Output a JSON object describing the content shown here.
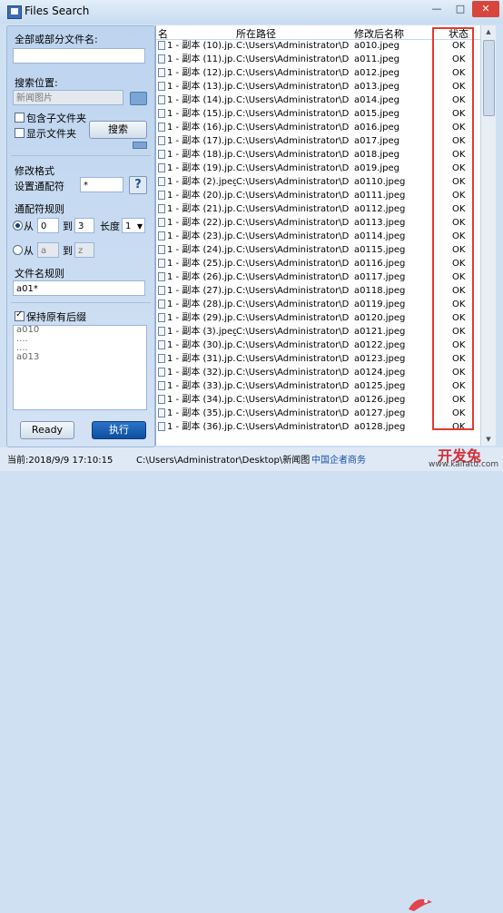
{
  "window": {
    "title": "Files Search",
    "min": "—",
    "max": "□",
    "close": "✕"
  },
  "left": {
    "name_label": "全部或部分文件名:",
    "name_value": "",
    "location_label": "搜索位置:",
    "location_value": "新闻图片",
    "include_subfolders": "包含子文件夹",
    "show_folders": "显示文件夹",
    "search_button": "搜索",
    "modify_format": "修改格式",
    "wildcard_label": "设置通配符",
    "wildcard_value": "*",
    "help_button": "?",
    "wildcard_rules": "通配符规则",
    "from1": "从",
    "from1_value": "0",
    "to1": "到",
    "to1_value": "3",
    "length_label": "长度",
    "length_value": "1",
    "from2": "从",
    "from2_value": "a",
    "to2": "到",
    "to2_value": "z",
    "filename_rule": "文件名规则",
    "filename_value": "a01*",
    "keep_ext": "保持原有后缀",
    "preview": [
      "a010",
      "....",
      "....",
      "a013"
    ],
    "ready_button": "Ready",
    "exec_button": "执行"
  },
  "grid": {
    "headers": [
      "名",
      "所在路径",
      "修改后名称",
      "状态"
    ],
    "rows": [
      [
        "1 - 副本 (10).jp...",
        "C:\\Users\\Administrator\\De...",
        "a010.jpeg",
        "OK"
      ],
      [
        "1 - 副本 (11).jp...",
        "C:\\Users\\Administrator\\De...",
        "a011.jpeg",
        "OK"
      ],
      [
        "1 - 副本 (12).jp...",
        "C:\\Users\\Administrator\\De...",
        "a012.jpeg",
        "OK"
      ],
      [
        "1 - 副本 (13).jp...",
        "C:\\Users\\Administrator\\De...",
        "a013.jpeg",
        "OK"
      ],
      [
        "1 - 副本 (14).jp...",
        "C:\\Users\\Administrator\\De...",
        "a014.jpeg",
        "OK"
      ],
      [
        "1 - 副本 (15).jp...",
        "C:\\Users\\Administrator\\De...",
        "a015.jpeg",
        "OK"
      ],
      [
        "1 - 副本 (16).jp...",
        "C:\\Users\\Administrator\\De...",
        "a016.jpeg",
        "OK"
      ],
      [
        "1 - 副本 (17).jp...",
        "C:\\Users\\Administrator\\De...",
        "a017.jpeg",
        "OK"
      ],
      [
        "1 - 副本 (18).jp...",
        "C:\\Users\\Administrator\\De...",
        "a018.jpeg",
        "OK"
      ],
      [
        "1 - 副本 (19).jp...",
        "C:\\Users\\Administrator\\De...",
        "a019.jpeg",
        "OK"
      ],
      [
        "1 - 副本 (2).jpeg",
        "C:\\Users\\Administrator\\De...",
        "a0110.jpeg",
        "OK"
      ],
      [
        "1 - 副本 (20).jp...",
        "C:\\Users\\Administrator\\De...",
        "a0111.jpeg",
        "OK"
      ],
      [
        "1 - 副本 (21).jp...",
        "C:\\Users\\Administrator\\De...",
        "a0112.jpeg",
        "OK"
      ],
      [
        "1 - 副本 (22).jp...",
        "C:\\Users\\Administrator\\De...",
        "a0113.jpeg",
        "OK"
      ],
      [
        "1 - 副本 (23).jp...",
        "C:\\Users\\Administrator\\De...",
        "a0114.jpeg",
        "OK"
      ],
      [
        "1 - 副本 (24).jp...",
        "C:\\Users\\Administrator\\De...",
        "a0115.jpeg",
        "OK"
      ],
      [
        "1 - 副本 (25).jp...",
        "C:\\Users\\Administrator\\De...",
        "a0116.jpeg",
        "OK"
      ],
      [
        "1 - 副本 (26).jp...",
        "C:\\Users\\Administrator\\De...",
        "a0117.jpeg",
        "OK"
      ],
      [
        "1 - 副本 (27).jp...",
        "C:\\Users\\Administrator\\De...",
        "a0118.jpeg",
        "OK"
      ],
      [
        "1 - 副本 (28).jp...",
        "C:\\Users\\Administrator\\De...",
        "a0119.jpeg",
        "OK"
      ],
      [
        "1 - 副本 (29).jp...",
        "C:\\Users\\Administrator\\De...",
        "a0120.jpeg",
        "OK"
      ],
      [
        "1 - 副本 (3).jpeg",
        "C:\\Users\\Administrator\\De...",
        "a0121.jpeg",
        "OK"
      ],
      [
        "1 - 副本 (30).jp...",
        "C:\\Users\\Administrator\\De...",
        "a0122.jpeg",
        "OK"
      ],
      [
        "1 - 副本 (31).jp...",
        "C:\\Users\\Administrator\\De...",
        "a0123.jpeg",
        "OK"
      ],
      [
        "1 - 副本 (32).jp...",
        "C:\\Users\\Administrator\\De...",
        "a0124.jpeg",
        "OK"
      ],
      [
        "1 - 副本 (33).jp...",
        "C:\\Users\\Administrator\\De...",
        "a0125.jpeg",
        "OK"
      ],
      [
        "1 - 副本 (34).jp...",
        "C:\\Users\\Administrator\\De...",
        "a0126.jpeg",
        "OK"
      ],
      [
        "1 - 副本 (35).jp...",
        "C:\\Users\\Administrator\\De...",
        "a0127.jpeg",
        "OK"
      ],
      [
        "1 - 副本 (36).jp...",
        "C:\\Users\\Administrator\\De...",
        "a0128.jpeg",
        "OK"
      ]
    ]
  },
  "statusbar": {
    "time": "当前:2018/9/9 17:10:15",
    "path": "C:\\Users\\Administrator\\Desktop\\新闻图",
    "watermark_cn": "中国企者商务",
    "watermark_brand": "开发兔",
    "watermark_url": "www.kaifatu.com"
  },
  "colors": {
    "accent": "#1a5fb4",
    "status_border": "#e53a2e",
    "exec_button": "#0e4f9e"
  }
}
